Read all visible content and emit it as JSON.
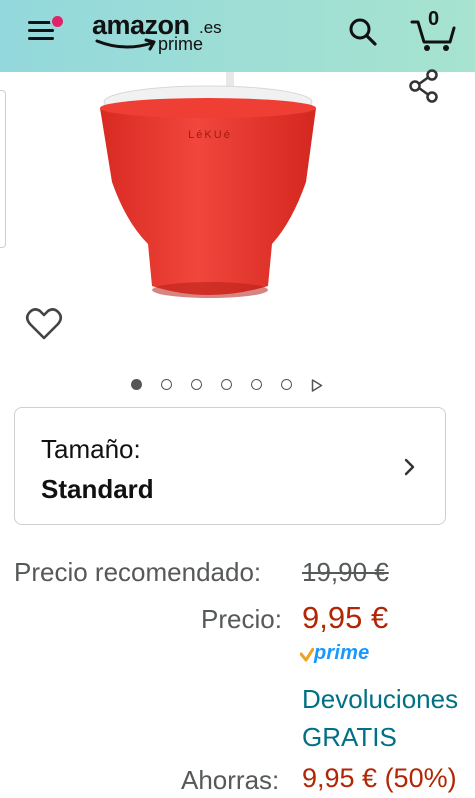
{
  "header": {
    "logo_text": "amazon",
    "logo_domain": ".es",
    "logo_sub": "prime",
    "cart_count": "0",
    "icons": [
      "menu-icon",
      "search-icon",
      "cart-icon"
    ],
    "colors": {
      "bar_gradient_start": "#93d8dc",
      "bar_gradient_end": "#a7e3cf",
      "notification_dot": "#e0226a"
    }
  },
  "gallery": {
    "product_brand_mark": "LéKUé",
    "product_color": "#e8322b",
    "image_count": 6,
    "active_index": 0,
    "icons": [
      "share-icon",
      "heart-icon",
      "play-icon"
    ]
  },
  "size_selector": {
    "label": "Tamaño:",
    "value": "Standard",
    "icon": "chevron-right-icon"
  },
  "pricing": {
    "list_price_label": "Precio recomendado:",
    "list_price": "19,90 €",
    "price_label": "Precio:",
    "price": "9,95 €",
    "prime_badge": "prime",
    "returns_line1": "Devoluciones",
    "returns_line2": "GRATIS",
    "savings_label": "Ahorras:",
    "savings": "9,95 € (50%)",
    "colors": {
      "price": "#b12704",
      "link": "#007185",
      "prime": "#1a98ff"
    }
  }
}
